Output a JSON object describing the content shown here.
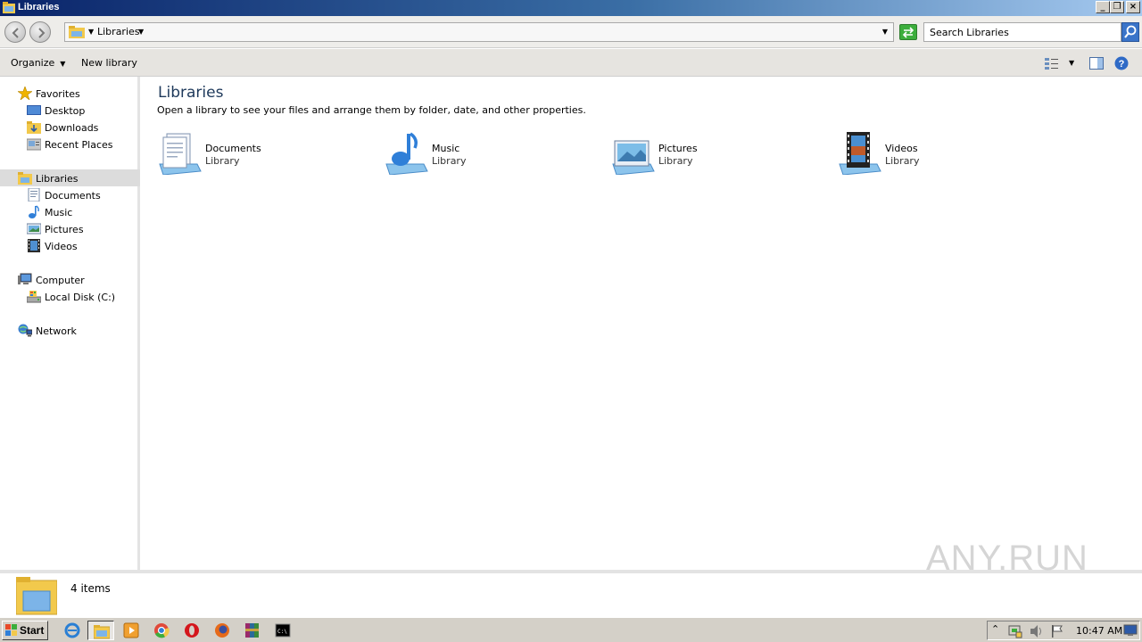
{
  "window": {
    "title": "Libraries"
  },
  "address": {
    "path": "Libraries",
    "search_placeholder": "Search Libraries"
  },
  "toolbar": {
    "organize": "Organize",
    "new_library": "New library"
  },
  "nav": {
    "favorites": "Favorites",
    "fav_items": [
      "Desktop",
      "Downloads",
      "Recent Places"
    ],
    "libraries": "Libraries",
    "lib_items": [
      "Documents",
      "Music",
      "Pictures",
      "Videos"
    ],
    "computer": "Computer",
    "computer_items": [
      "Local Disk (C:)"
    ],
    "network": "Network"
  },
  "main": {
    "title": "Libraries",
    "description": "Open a library to see your files and arrange them by folder, date, and other properties.",
    "libraries": [
      {
        "name": "Documents",
        "type": "Library",
        "icon": "documents-library-icon"
      },
      {
        "name": "Music",
        "type": "Library",
        "icon": "music-library-icon"
      },
      {
        "name": "Pictures",
        "type": "Library",
        "icon": "pictures-library-icon"
      },
      {
        "name": "Videos",
        "type": "Library",
        "icon": "videos-library-icon"
      }
    ]
  },
  "details": {
    "item_count": "4 items"
  },
  "watermark": "ANY.RUN",
  "taskbar": {
    "start_label": "Start",
    "clock": "10:47 AM"
  },
  "colors": {
    "title_gradient_start": "#0a246a",
    "title_gradient_end": "#a6caf0",
    "heading_blue": "#1e395b",
    "selection_gray": "#dcdcdc"
  }
}
